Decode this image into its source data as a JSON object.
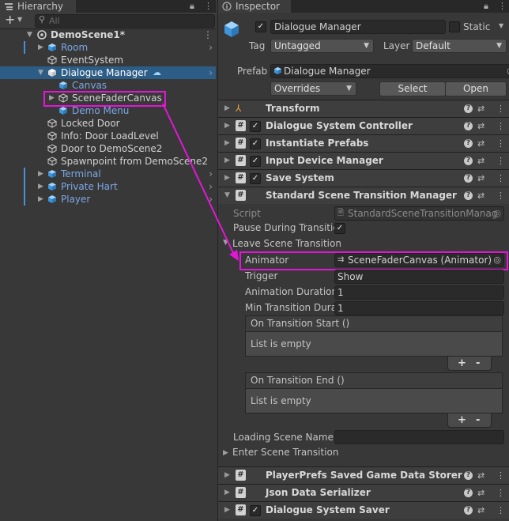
{
  "hierarchy": {
    "tab_label": "Hierarchy",
    "search_placeholder": "All",
    "add_label": "+",
    "scene": "DemoScene1*",
    "items": [
      {
        "label": "Room",
        "color": "blue"
      },
      {
        "label": "EventSystem",
        "color": "white"
      },
      {
        "label": "Dialogue Manager",
        "color": "white"
      },
      {
        "label": "Canvas",
        "color": "blue"
      },
      {
        "label": "SceneFaderCanvas",
        "color": "white"
      },
      {
        "label": "Demo Menu",
        "color": "blue"
      },
      {
        "label": "Locked Door",
        "color": "white"
      },
      {
        "label": "Info: Door LoadLevel",
        "color": "white"
      },
      {
        "label": "Door to DemoScene2",
        "color": "white"
      },
      {
        "label": "Spawnpoint from DemoScene2",
        "color": "white"
      },
      {
        "label": "Terminal",
        "color": "blue"
      },
      {
        "label": "Private Hart",
        "color": "blue"
      },
      {
        "label": "Player",
        "color": "blue"
      }
    ]
  },
  "inspector": {
    "tab_label": "Inspector",
    "object_name": "Dialogue Manager",
    "static_label": "Static",
    "tag_label": "Tag",
    "tag_value": "Untagged",
    "layer_label": "Layer",
    "layer_value": "Default",
    "prefab_label": "Prefab",
    "prefab_value": "Dialogue Manager",
    "overrides_label": "Overrides",
    "select_label": "Select",
    "open_label": "Open",
    "components_top": [
      {
        "name": "Transform",
        "checkbox": false
      },
      {
        "name": "Dialogue System Controller",
        "checkbox": true
      },
      {
        "name": "Instantiate Prefabs",
        "checkbox": true
      },
      {
        "name": "Input Device Manager",
        "checkbox": true
      },
      {
        "name": "Save System",
        "checkbox": true
      },
      {
        "name": "Standard Scene Transition Manager",
        "checkbox": false
      }
    ],
    "sstm": {
      "script_label": "Script",
      "script_value": "StandardSceneTransitionManag",
      "pause_label": "Pause During Transitic",
      "leave_label": "Leave Scene Transition",
      "animator_label": "Animator",
      "animator_value": "SceneFaderCanvas (Animator)",
      "trigger_label": "Trigger",
      "trigger_value": "Show",
      "anim_dur_label": "Animation Duration",
      "anim_dur_value": "1",
      "min_trans_label": "Min Transition Dura",
      "min_trans_value": "1",
      "on_start_label": "On Transition Start ()",
      "on_end_label": "On Transition End ()",
      "list_empty": "List is empty",
      "plus": "+",
      "minus": "-",
      "loading_label": "Loading Scene Name",
      "enter_label": "Enter Scene Transition"
    },
    "components_bottom": [
      {
        "name": "PlayerPrefs Saved Game Data Storer",
        "checkbox": false
      },
      {
        "name": "Json Data Serializer",
        "checkbox": false
      },
      {
        "name": "Dialogue System Saver",
        "checkbox": true
      }
    ]
  },
  "colors": {
    "selection": "#2c5d87",
    "annotation": "#e316d8",
    "prefab_blue": "#7ca8e6"
  }
}
